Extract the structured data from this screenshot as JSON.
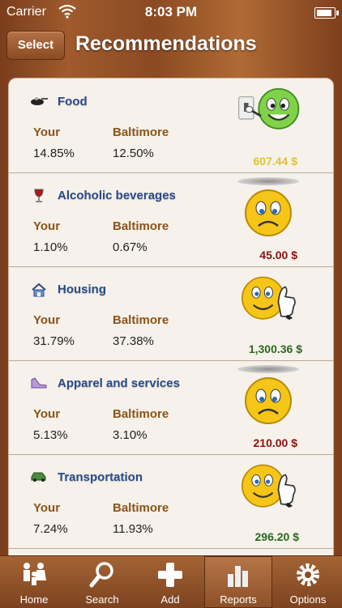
{
  "status": {
    "carrier": "Carrier",
    "time": "8:03 PM"
  },
  "nav": {
    "back_label": "Select",
    "title": "Recommendations"
  },
  "columns": {
    "your": "Your",
    "city": "Baltimore"
  },
  "rows": [
    {
      "category": "Food",
      "your": "14.85%",
      "city": "12.50%",
      "amount": "607.44 $",
      "amount_color": "#e0c23a",
      "mood": "happy-pointing",
      "icon": "food-icon"
    },
    {
      "category": "Alcoholic beverages",
      "your": "1.10%",
      "city": "0.67%",
      "amount": "45.00 $",
      "amount_color": "#8a1111",
      "mood": "sad",
      "icon": "wine-glass-icon"
    },
    {
      "category": "Housing",
      "your": "31.79%",
      "city": "37.38%",
      "amount": "1,300.36 $",
      "amount_color": "#2a6a1e",
      "mood": "thumbs-up",
      "icon": "house-icon"
    },
    {
      "category": "Apparel and services",
      "your": "5.13%",
      "city": "3.10%",
      "amount": "210.00 $",
      "amount_color": "#8a1111",
      "mood": "sad",
      "icon": "shoe-icon"
    },
    {
      "category": "Transportation",
      "your": "7.24%",
      "city": "11.93%",
      "amount": "296.20 $",
      "amount_color": "#2a6a1e",
      "mood": "thumbs-up",
      "icon": "car-icon"
    }
  ],
  "tabs": [
    {
      "label": "Home",
      "icon": "family-icon"
    },
    {
      "label": "Search",
      "icon": "magnifier-icon"
    },
    {
      "label": "Add",
      "icon": "plus-icon"
    },
    {
      "label": "Reports",
      "icon": "bar-chart-icon",
      "active": true
    },
    {
      "label": "Options",
      "icon": "gear-icon"
    }
  ]
}
